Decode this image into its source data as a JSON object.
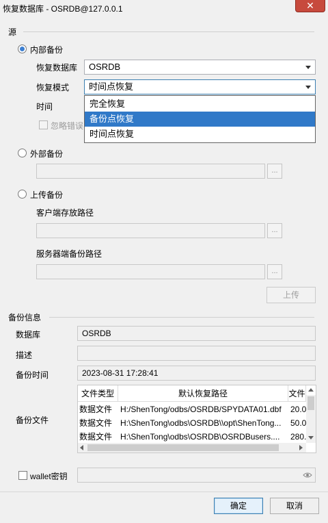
{
  "window": {
    "title": "恢复数据库 - OSRDB@127.0.0.1",
    "close_symbol": "✕"
  },
  "source": {
    "section_label": "源",
    "internal_backup": {
      "label": "内部备份",
      "restore_db_label": "恢复数据库",
      "restore_db_value": "OSRDB",
      "restore_mode_label": "恢复模式",
      "restore_mode_value": "时间点恢复",
      "time_label": "时间",
      "ignore_errors_label": "忽略错误",
      "mode_options": [
        "完全恢复",
        "备份点恢复",
        "时间点恢复"
      ],
      "highlighted_option_index": 1
    },
    "external_backup": {
      "label": "外部备份",
      "browse_label": "..."
    },
    "upload_backup": {
      "label": "上传备份",
      "client_path_label": "客户端存放路径",
      "server_path_label": "服务器端备份路径",
      "browse_label": "...",
      "upload_button": "上传"
    }
  },
  "backup_info": {
    "section_label": "备份信息",
    "database_label": "数据库",
    "database_value": "OSRDB",
    "description_label": "描述",
    "description_value": "",
    "backup_time_label": "备份时间",
    "backup_time_value": "2023-08-31 17:28:41",
    "backup_files_label": "备份文件",
    "table": {
      "columns": [
        "文件类型",
        "默认恢复路径",
        "文件"
      ],
      "rows": [
        [
          "数据文件",
          "H:/ShenTong/odbs/OSRDB/SPYDATA01.dbf",
          "20.0"
        ],
        [
          "数据文件",
          "H:\\ShenTong\\odbs\\OSRDB\\\\opt\\ShenTong...",
          "50.0"
        ],
        [
          "数据文件",
          "H:\\ShenTong\\odbs\\OSRDB\\OSRDBusers....",
          "280."
        ]
      ]
    }
  },
  "wallet": {
    "label": "wallet密钥"
  },
  "footer": {
    "ok_button": "确定",
    "cancel_button": "取消"
  },
  "colors": {
    "selection": "#3079c8",
    "close_button": "#c74a3d",
    "radio_accent": "#3d7fd1"
  }
}
